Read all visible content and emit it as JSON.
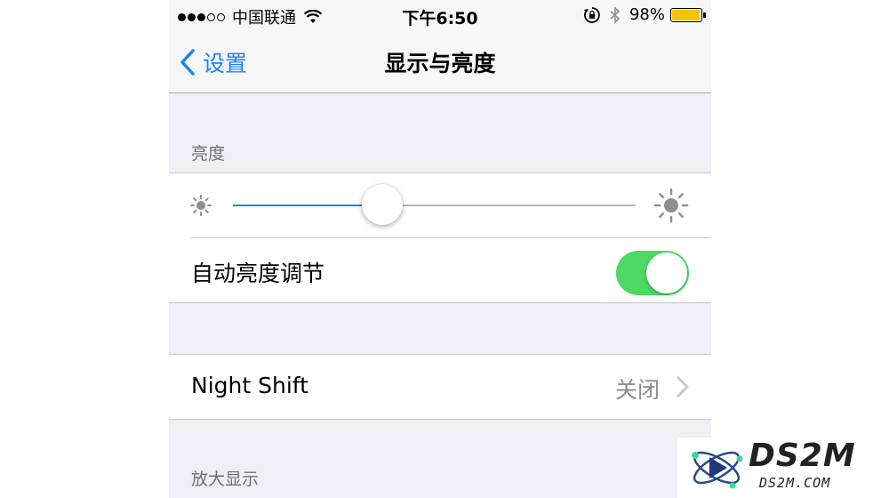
{
  "status_bar": {
    "carrier": "中国联通",
    "signal_bars": 3,
    "signal_total": 5,
    "time": "下午6:50",
    "battery_text": "98%",
    "battery_level": 0.98,
    "battery_color": "#f6c500"
  },
  "nav": {
    "back_label": "设置",
    "title": "显示与亮度"
  },
  "brightness": {
    "header": "亮度",
    "level": 0.37,
    "auto_label": "自动亮度调节",
    "auto_on": true
  },
  "night_shift": {
    "label": "Night Shift",
    "value": "关闭"
  },
  "zoom": {
    "header": "放大显示"
  },
  "watermark": {
    "title": "DS2M",
    "url": "DS2M.COM"
  },
  "colors": {
    "accent": "#1a82fb",
    "toggle_on": "#4cd964"
  }
}
